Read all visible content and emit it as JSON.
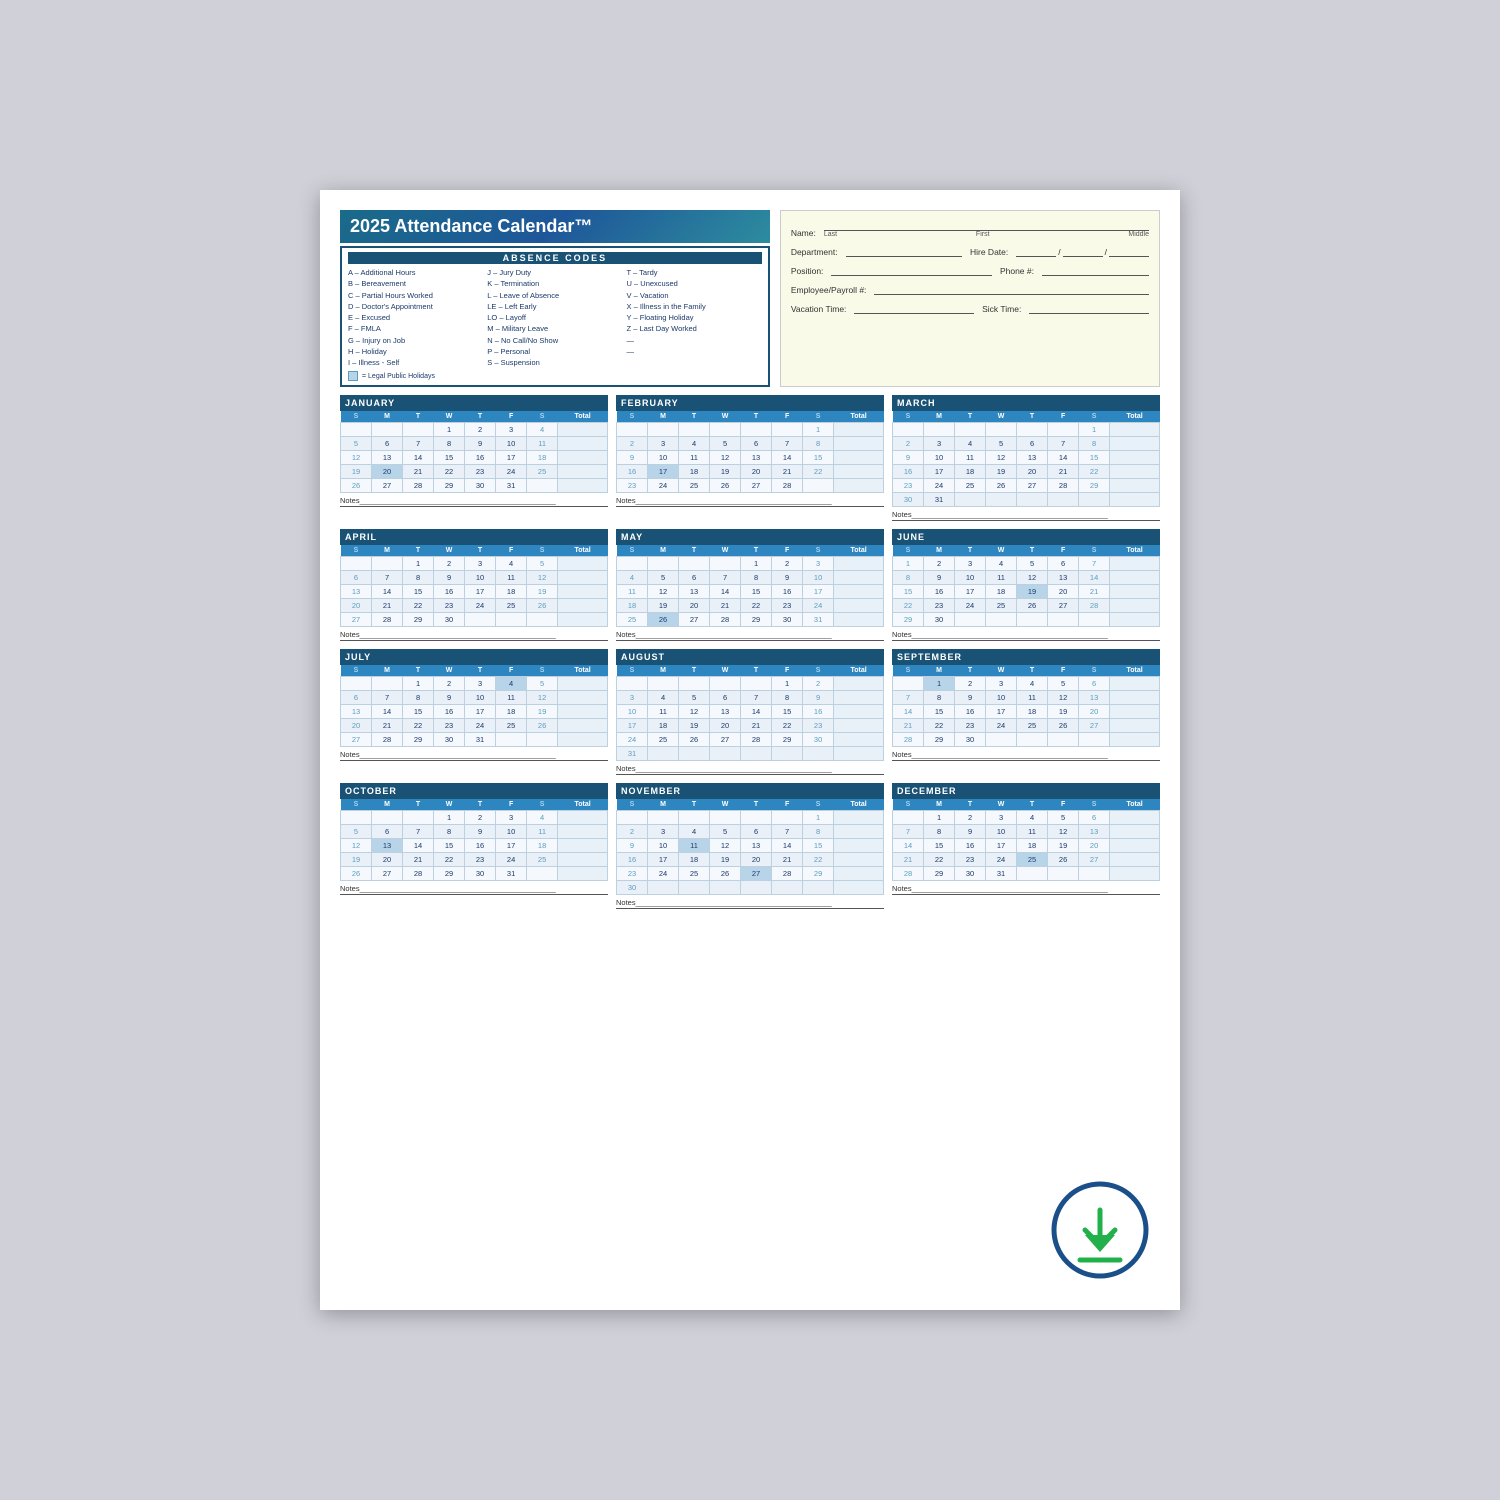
{
  "title": "2025 Attendance Calendar™",
  "absence_header": "ABSENCE CODES",
  "codes_col1": [
    "A – Additional Hours",
    "B – Bereavement",
    "C – Partial Hours Worked",
    "D – Doctor's Appointment",
    "E – Excused",
    "F – FMLA",
    "G – Injury on Job",
    "H – Holiday",
    "I  – Illness - Self"
  ],
  "codes_col2": [
    "J  – Jury Duty",
    "K – Termination",
    "L  – Leave of Absence",
    "LE – Left Early",
    "LO – Layoff",
    "M – Military Leave",
    "N – No Call/No Show",
    "P  – Personal",
    "S  – Suspension"
  ],
  "codes_col3": [
    "T  – Tardy",
    "U – Unexcused",
    "V – Vacation",
    "X – Illness in the Family",
    "Y – Floating Holiday",
    "Z – Last Day Worked",
    "—",
    "—",
    ""
  ],
  "holiday_note": "= Legal Public Holidays",
  "form": {
    "name_label": "Name:",
    "last_label": "Last",
    "first_label": "First",
    "middle_label": "Middle",
    "dept_label": "Department:",
    "hire_label": "Hire Date:",
    "position_label": "Position:",
    "phone_label": "Phone #:",
    "emp_label": "Employee/Payroll #:",
    "vac_label": "Vacation Time:",
    "sick_label": "Sick Time:"
  },
  "months": [
    {
      "name": "JANUARY",
      "days_header": [
        "S",
        "M",
        "T",
        "W",
        "T",
        "F",
        "S",
        "Total"
      ],
      "rows": [
        [
          "",
          "",
          "",
          "1",
          "2",
          "3",
          "4",
          ""
        ],
        [
          "5",
          "6",
          "7",
          "8",
          "9",
          "10",
          "11",
          ""
        ],
        [
          "12",
          "13",
          "14",
          "15",
          "16",
          "17",
          "18",
          ""
        ],
        [
          "19",
          "20h",
          "21",
          "22",
          "23",
          "24",
          "25",
          ""
        ],
        [
          "26",
          "27",
          "28",
          "29",
          "30",
          "31",
          "",
          ""
        ]
      ],
      "highlights": {
        "row1col3": "holiday",
        "row4col1": "green20"
      }
    },
    {
      "name": "FEBRUARY",
      "rows": [
        [
          "",
          "",
          "",
          "",
          "",
          "",
          "1",
          ""
        ],
        [
          "2",
          "3",
          "4",
          "5",
          "6",
          "7",
          "8",
          ""
        ],
        [
          "9",
          "10",
          "11",
          "12",
          "13",
          "14",
          "15",
          ""
        ],
        [
          "16",
          "17h",
          "18",
          "19",
          "20",
          "21",
          "22",
          ""
        ],
        [
          "23",
          "24",
          "25",
          "26",
          "27",
          "28",
          "",
          ""
        ]
      ]
    },
    {
      "name": "MARCH",
      "rows": [
        [
          "",
          "",
          "",
          "",
          "",
          "",
          "1",
          ""
        ],
        [
          "2",
          "3",
          "4",
          "5",
          "6",
          "7",
          "8",
          ""
        ],
        [
          "9",
          "10",
          "11",
          "12",
          "13",
          "14",
          "15",
          ""
        ],
        [
          "16",
          "17",
          "18",
          "19",
          "20",
          "21",
          "22",
          ""
        ],
        [
          "23",
          "24",
          "25",
          "26",
          "27",
          "28",
          "29",
          ""
        ],
        [
          "30",
          "31",
          "",
          "",
          "",
          "",
          "",
          ""
        ]
      ]
    },
    {
      "name": "APRIL",
      "rows": [
        [
          "",
          "",
          "1",
          "2",
          "3",
          "4",
          "5",
          ""
        ],
        [
          "6",
          "7",
          "8",
          "9",
          "10",
          "11",
          "12",
          ""
        ],
        [
          "13",
          "14",
          "15",
          "16",
          "17",
          "18",
          "19",
          ""
        ],
        [
          "20",
          "21",
          "22",
          "23",
          "24",
          "25",
          "26",
          ""
        ],
        [
          "27",
          "28",
          "29",
          "30",
          "",
          "",
          "",
          ""
        ]
      ]
    },
    {
      "name": "MAY",
      "rows": [
        [
          "",
          "",
          "",
          "",
          "1",
          "2",
          "3",
          ""
        ],
        [
          "4",
          "5",
          "6",
          "7",
          "8",
          "9",
          "10",
          ""
        ],
        [
          "11",
          "12",
          "13",
          "14",
          "15",
          "16",
          "17",
          ""
        ],
        [
          "18",
          "19",
          "20",
          "21",
          "22",
          "23",
          "24",
          ""
        ],
        [
          "25",
          "26h",
          "27",
          "28",
          "29",
          "30",
          "31",
          ""
        ]
      ]
    },
    {
      "name": "JUNE",
      "rows": [
        [
          "1",
          "2",
          "3",
          "4",
          "5",
          "6",
          "7",
          ""
        ],
        [
          "8",
          "9",
          "10",
          "11",
          "12",
          "13",
          "14",
          ""
        ],
        [
          "15",
          "16",
          "17",
          "18",
          "19h",
          "20",
          "21",
          ""
        ],
        [
          "22",
          "23",
          "24",
          "25",
          "26",
          "27",
          "28",
          ""
        ],
        [
          "29",
          "30",
          "",
          "",
          "",
          "",
          "",
          ""
        ]
      ]
    },
    {
      "name": "JULY",
      "rows": [
        [
          "",
          "",
          "1",
          "2",
          "3",
          "4h",
          "5",
          ""
        ],
        [
          "6",
          "7",
          "8",
          "9",
          "10",
          "11",
          "12",
          ""
        ],
        [
          "13",
          "14",
          "15",
          "16",
          "17",
          "18",
          "19",
          ""
        ],
        [
          "20",
          "21",
          "22",
          "23",
          "24",
          "25",
          "26",
          ""
        ],
        [
          "27",
          "28",
          "29",
          "30",
          "31",
          "",
          "",
          ""
        ]
      ]
    },
    {
      "name": "AUGUST",
      "rows": [
        [
          "",
          "",
          "",
          "",
          "",
          "1",
          "2",
          ""
        ],
        [
          "3",
          "4",
          "5",
          "6",
          "7",
          "8",
          "9",
          ""
        ],
        [
          "10",
          "11",
          "12",
          "13",
          "14",
          "15",
          "16",
          ""
        ],
        [
          "17",
          "18",
          "19",
          "20",
          "21",
          "22",
          "23",
          ""
        ],
        [
          "24",
          "25",
          "26",
          "27",
          "28",
          "29",
          "30",
          ""
        ],
        [
          "31",
          "",
          "",
          "",
          "",
          "",
          "",
          ""
        ]
      ]
    },
    {
      "name": "SEPTEMBER",
      "rows": [
        [
          "",
          "1h",
          "2",
          "3",
          "4",
          "5",
          "6",
          ""
        ],
        [
          "7",
          "8",
          "9",
          "10",
          "11",
          "12",
          "13",
          ""
        ],
        [
          "14",
          "15",
          "16",
          "17",
          "18",
          "19",
          "20",
          ""
        ],
        [
          "21",
          "22",
          "23",
          "24",
          "25",
          "26",
          "27",
          ""
        ],
        [
          "28",
          "29",
          "30",
          "",
          "",
          "",
          "",
          ""
        ]
      ]
    },
    {
      "name": "OCTOBER",
      "rows": [
        [
          "",
          "",
          "",
          "1",
          "2",
          "3",
          "4",
          ""
        ],
        [
          "5",
          "6",
          "7",
          "8",
          "9",
          "10",
          "11",
          ""
        ],
        [
          "12",
          "13h",
          "14",
          "15",
          "16",
          "17",
          "18",
          ""
        ],
        [
          "19",
          "20",
          "21",
          "22",
          "23",
          "24",
          "25",
          ""
        ],
        [
          "26",
          "27",
          "28",
          "29",
          "30",
          "31",
          "",
          ""
        ]
      ]
    },
    {
      "name": "NOVEMBER",
      "rows": [
        [
          "",
          "",
          "",
          "",
          "",
          "",
          "1",
          ""
        ],
        [
          "2",
          "3",
          "4",
          "5",
          "6",
          "7",
          "8",
          ""
        ],
        [
          "9",
          "10",
          "11h",
          "12",
          "13",
          "14",
          "15",
          ""
        ],
        [
          "16",
          "17",
          "18",
          "19",
          "20",
          "21",
          "22",
          ""
        ],
        [
          "23",
          "24",
          "25",
          "26",
          "27h",
          "28",
          "29",
          ""
        ],
        [
          "30",
          "",
          "",
          "",
          "",
          "",
          "",
          ""
        ]
      ]
    },
    {
      "name": "DECEMBER",
      "rows": [
        [
          "",
          "1",
          "2",
          "3",
          "4",
          "5",
          "6",
          ""
        ],
        [
          "7",
          "8",
          "9",
          "10",
          "11",
          "12",
          "13",
          ""
        ],
        [
          "14",
          "15",
          "16",
          "17",
          "18",
          "19",
          "20",
          ""
        ],
        [
          "21",
          "22",
          "23",
          "24",
          "25h",
          "26",
          "27",
          ""
        ],
        [
          "28",
          "29",
          "30",
          "31",
          "",
          "",
          "",
          ""
        ]
      ]
    }
  ],
  "notes_label": "Notes"
}
